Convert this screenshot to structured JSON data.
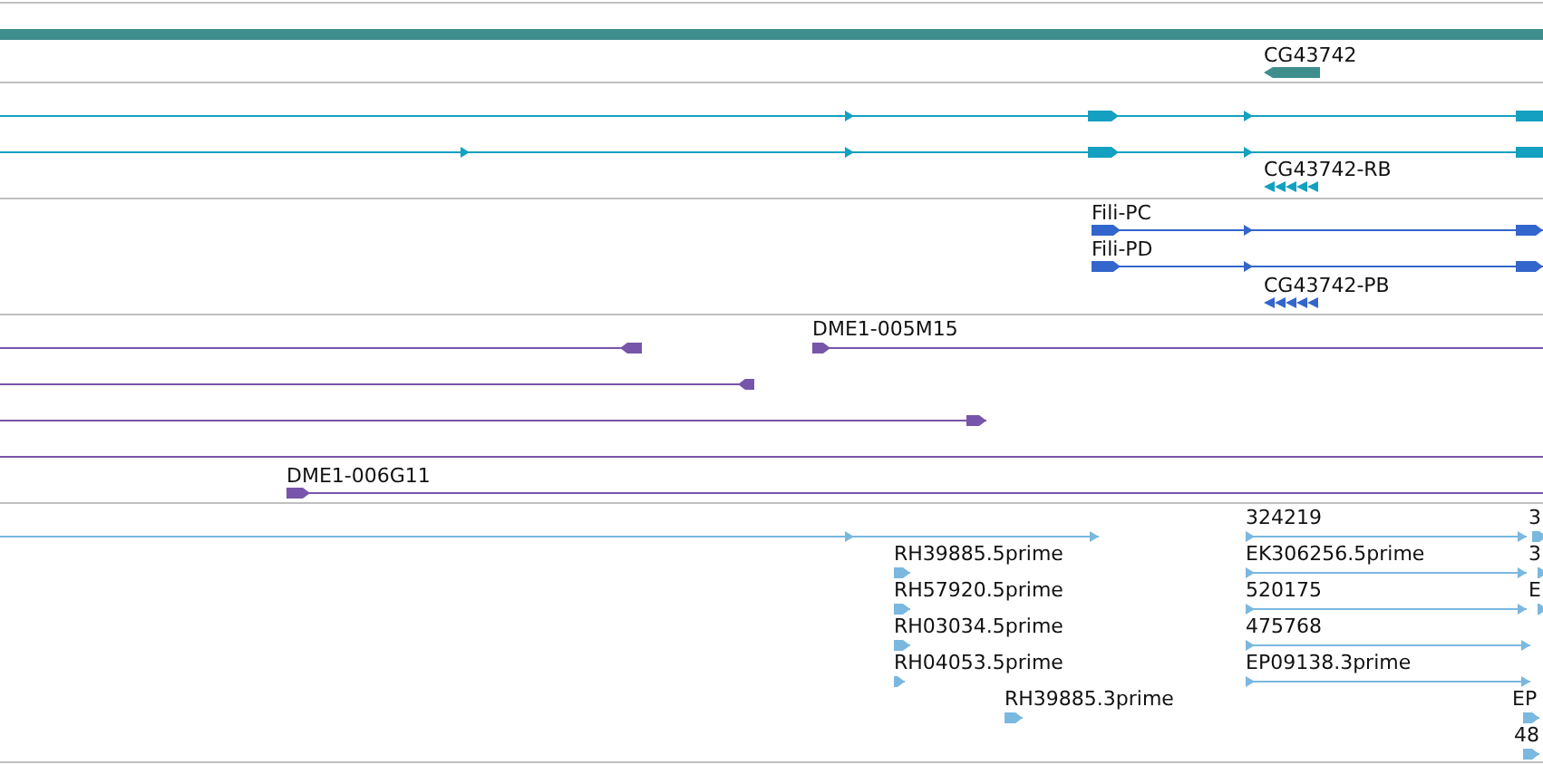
{
  "tracks": [
    {
      "labels": [
        "CG43742"
      ]
    },
    {
      "labels": [
        "CG43742-RB"
      ]
    },
    {
      "labels": [
        "Fili-PC",
        "Fili-PD",
        "CG43742-PB"
      ]
    },
    {
      "labels": [
        "DME1-005M15",
        "DME1-006G11"
      ]
    },
    {
      "labels": [
        "RH39885.5prime",
        "RH57920.5prime",
        "RH03034.5prime",
        "RH04053.5prime",
        "RH39885.3prime",
        "324219",
        "EK306256.5prime",
        "520175",
        "475768",
        "EP09138.3prime",
        "3",
        "3",
        "E",
        "EP",
        "48"
      ]
    }
  ]
}
